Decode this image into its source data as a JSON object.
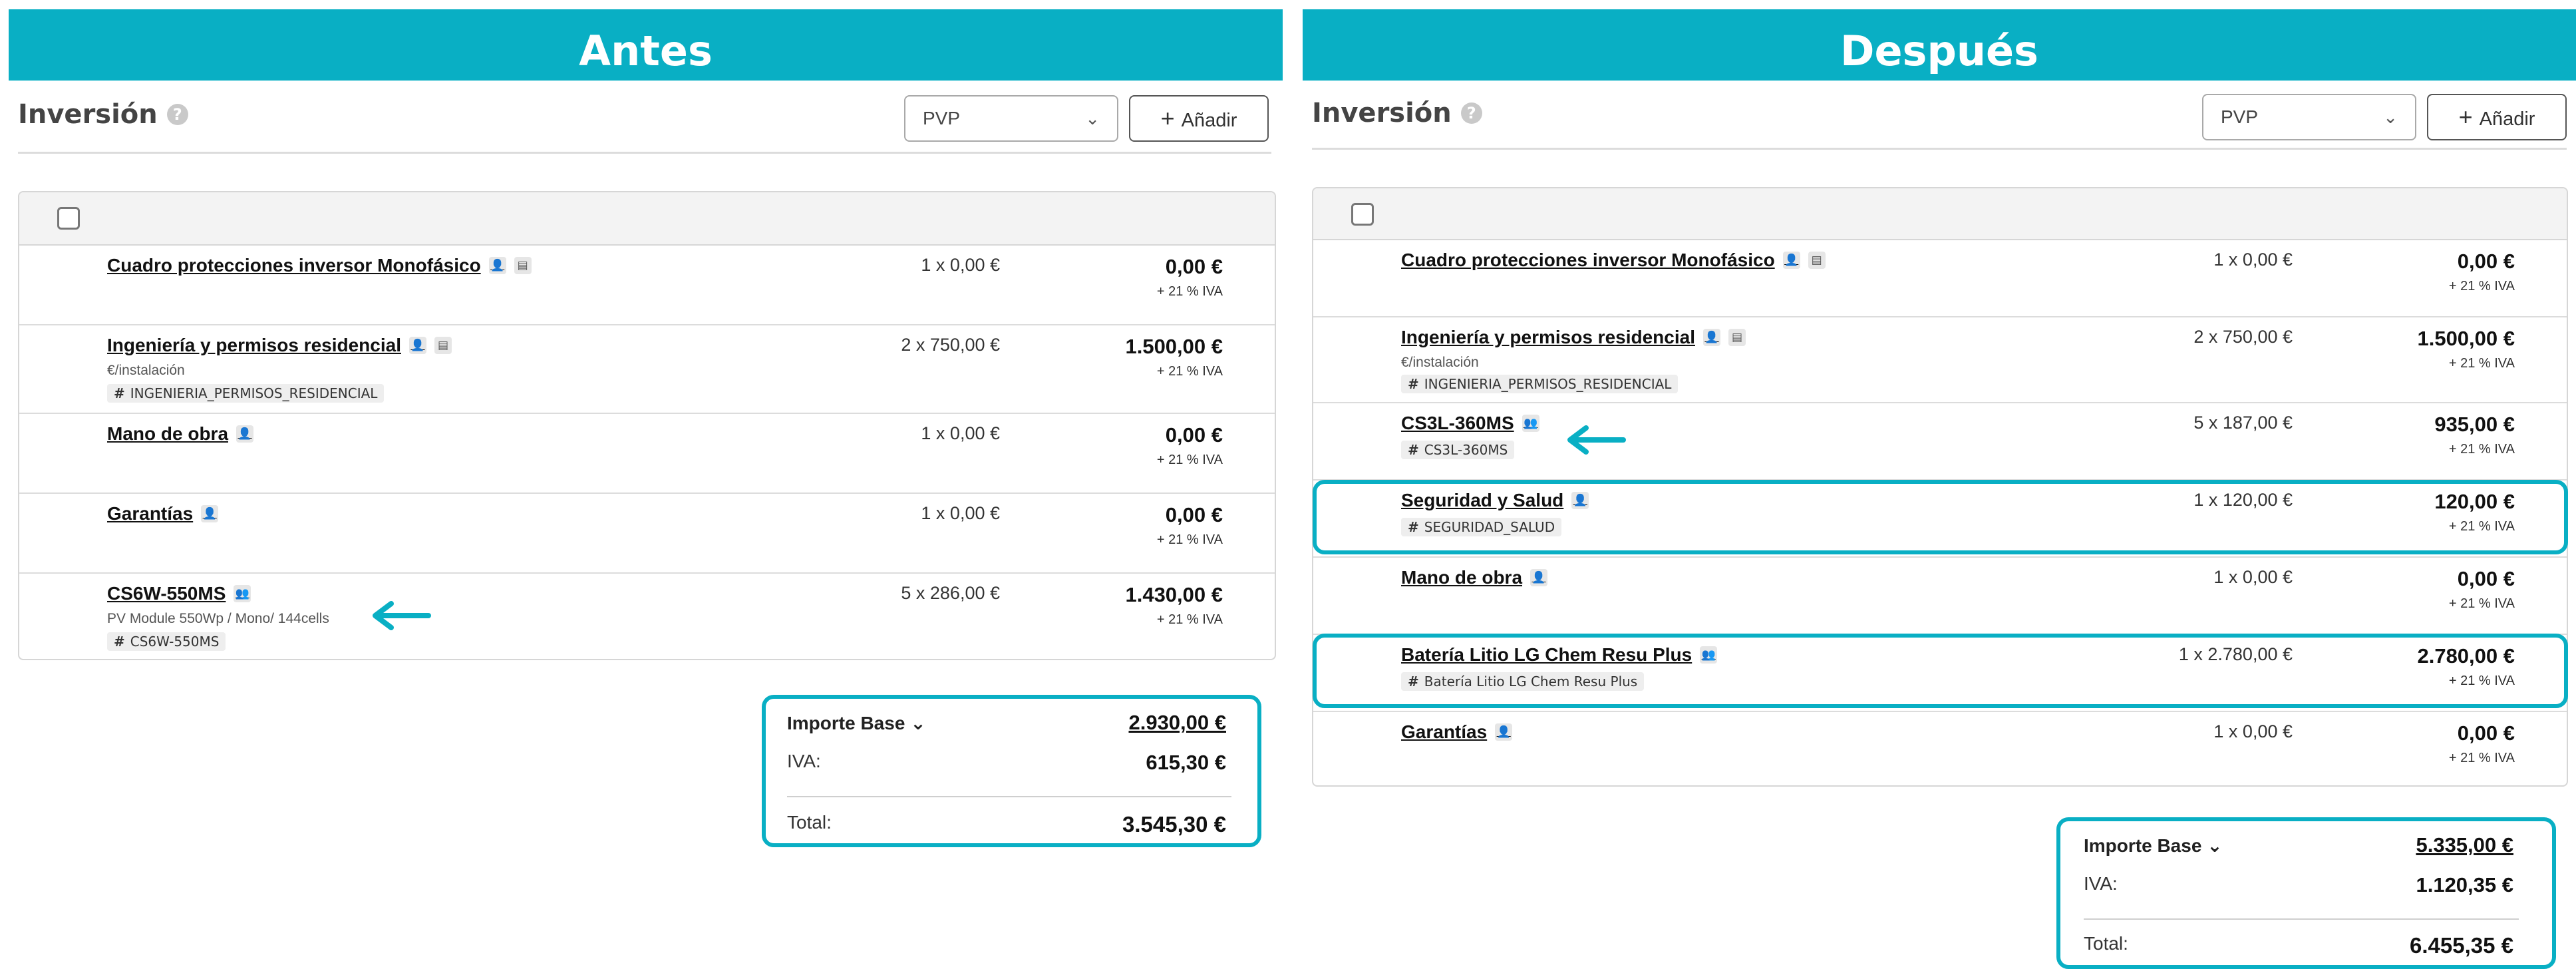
{
  "accent_color": "#09afc4",
  "antes": {
    "banner": "Antes",
    "title": "Inversión",
    "help_icon": "?",
    "select_value": "PVP",
    "add_label": "Añadir",
    "rows": [
      {
        "name": "Cuadro protecciones inversor Monofásico",
        "sub": "",
        "tag": "",
        "qty": "1 x 0,00 €",
        "amount": "0,00 €",
        "iva": "+ 21 % IVA"
      },
      {
        "name": "Ingeniería y permisos residencial",
        "sub": "€/instalación",
        "tag": "INGENIERIA_PERMISOS_RESIDENCIAL",
        "qty": "2 x 750,00 €",
        "amount": "1.500,00 €",
        "iva": "+ 21 % IVA"
      },
      {
        "name": "Mano de obra",
        "sub": "",
        "tag": "",
        "qty": "1 x 0,00 €",
        "amount": "0,00 €",
        "iva": "+ 21 % IVA"
      },
      {
        "name": "Garantías",
        "sub": "",
        "tag": "",
        "qty": "1 x 0,00 €",
        "amount": "0,00 €",
        "iva": "+ 21 % IVA"
      },
      {
        "name": "CS6W-550MS",
        "sub": "PV Module 550Wp / Mono/ 144cells",
        "tag": "CS6W-550MS",
        "qty": "5 x 286,00 €",
        "amount": "1.430,00 €",
        "iva": "+ 21 % IVA"
      }
    ],
    "totals": {
      "base_label": "Importe Base",
      "base_value": "2.930,00 €",
      "iva_label": "IVA:",
      "iva_value": "615,30 €",
      "total_label": "Total:",
      "total_value": "3.545,30 €"
    }
  },
  "despues": {
    "banner": "Después",
    "title": "Inversión",
    "help_icon": "?",
    "select_value": "PVP",
    "add_label": "Añadir",
    "rows": [
      {
        "name": "Cuadro protecciones inversor Monofásico",
        "sub": "",
        "tag": "",
        "qty": "1 x 0,00 €",
        "amount": "0,00 €",
        "iva": "+ 21 % IVA"
      },
      {
        "name": "Ingeniería y permisos residencial",
        "sub": "€/instalación",
        "tag": "INGENIERIA_PERMISOS_RESIDENCIAL",
        "qty": "2 x 750,00 €",
        "amount": "1.500,00 €",
        "iva": "+ 21 % IVA"
      },
      {
        "name": "CS3L-360MS",
        "sub": "",
        "tag": "CS3L-360MS",
        "qty": "5 x 187,00 €",
        "amount": "935,00 €",
        "iva": "+ 21 % IVA"
      },
      {
        "name": "Seguridad y Salud",
        "sub": "",
        "tag": "SEGURIDAD_SALUD",
        "qty": "1 x 120,00 €",
        "amount": "120,00 €",
        "iva": "+ 21 % IVA"
      },
      {
        "name": "Mano de obra",
        "sub": "",
        "tag": "",
        "qty": "1 x 0,00 €",
        "amount": "0,00 €",
        "iva": "+ 21 % IVA"
      },
      {
        "name": "Batería Litio LG Chem Resu Plus",
        "sub": "",
        "tag": "Batería Litio LG Chem Resu Plus",
        "qty": "1 x 2.780,00 €",
        "amount": "2.780,00 €",
        "iva": "+ 21 % IVA"
      },
      {
        "name": "Garantías",
        "sub": "",
        "tag": "",
        "qty": "1 x 0,00 €",
        "amount": "0,00 €",
        "iva": "+ 21 % IVA"
      }
    ],
    "totals": {
      "base_label": "Importe Base",
      "base_value": "5.335,00 €",
      "iva_label": "IVA:",
      "iva_value": "1.120,35 €",
      "total_label": "Total:",
      "total_value": "6.455,35 €"
    }
  }
}
